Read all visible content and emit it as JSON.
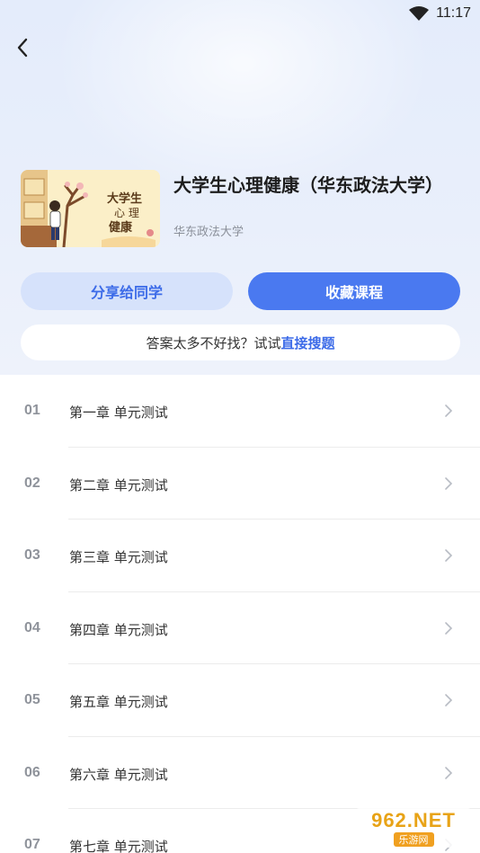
{
  "status": {
    "time": "11:17"
  },
  "course": {
    "title": "大学生心理健康（华东政法大学）",
    "school": "华东政法大学",
    "cover_text": "大学生心理健康"
  },
  "actions": {
    "share_label": "分享给同学",
    "favorite_label": "收藏课程"
  },
  "search_tip": {
    "prefix": "答案太多不好找？试试",
    "link": "直接搜题"
  },
  "chapters": [
    {
      "num": "01",
      "title": "第一章 单元测试"
    },
    {
      "num": "02",
      "title": "第二章 单元测试"
    },
    {
      "num": "03",
      "title": "第三章 单元测试"
    },
    {
      "num": "04",
      "title": "第四章 单元测试"
    },
    {
      "num": "05",
      "title": "第五章 单元测试"
    },
    {
      "num": "06",
      "title": "第六章 单元测试"
    },
    {
      "num": "07",
      "title": "第七章 单元测试"
    }
  ],
  "watermark": {
    "brand": "962.NET",
    "sub": "乐游网"
  },
  "colors": {
    "accent": "#4a79f0",
    "accent_light": "#d6e2fb",
    "link": "#3c6be8",
    "header_bg": "#e7eefb"
  },
  "icons": [
    "wifi-icon",
    "back-arrow-icon",
    "chevron-right-icon"
  ]
}
